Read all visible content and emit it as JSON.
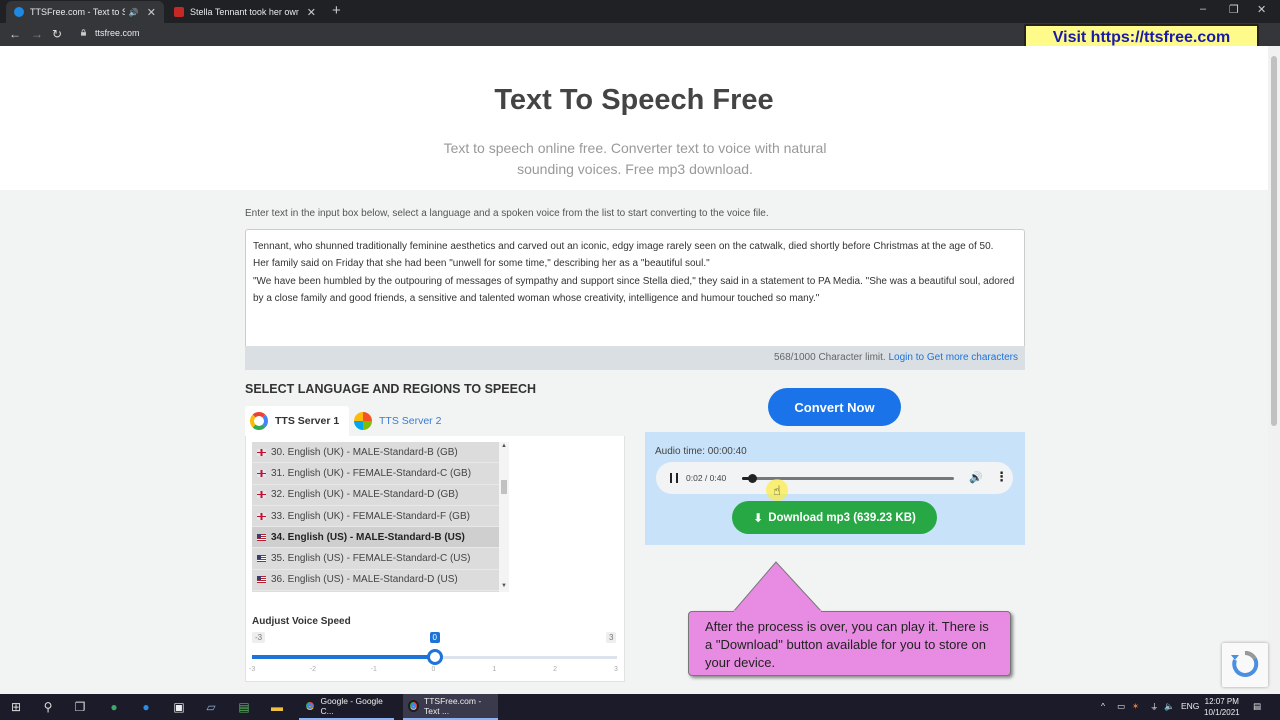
{
  "browser": {
    "tabs": [
      {
        "title": "TTSFree.com - Text to Speech",
        "icon": "ttsfree-favicon",
        "active": true
      },
      {
        "title": "Stella Tennant took her own life,",
        "icon": "news-favicon",
        "active": false
      }
    ],
    "url": "ttsfree.com",
    "window_controls": [
      "–",
      "❐",
      "✕"
    ]
  },
  "promo_banner": "Visit https://ttsfree.com",
  "hero": {
    "title": "Text To Speech Free",
    "subtitle": "Text to speech online free. Converter text to voice with natural sounding voices. Free mp3 download."
  },
  "instructions": "Enter text in the input box below, select a language and a spoken voice from the list to start converting to the voice file.",
  "input_text": [
    "Tennant, who shunned traditionally feminine aesthetics and carved out an iconic, edgy image rarely seen on the catwalk, died shortly before Christmas at the age of 50.",
    "Her family said on Friday that she had been \"unwell for some time,\" describing her as a \"beautiful soul.\"",
    "\"We have been humbled by the outpouring of messages of sympathy and support since Stella died,\" they said in a statement to PA Media. \"She was a beautiful soul, adored by a close family and good friends, a sensitive and talented woman whose creativity, intelligence and humour touched so many.\""
  ],
  "char_limit": {
    "count": "568/1000 Character limit.",
    "link": "Login to Get more characters"
  },
  "language_section_title": "SELECT LANGUAGE AND REGIONS TO SPEECH",
  "server_tabs": [
    {
      "label": "TTS Server 1",
      "icon": "google-icon",
      "active": true
    },
    {
      "label": "TTS Server 2",
      "icon": "microsoft-icon",
      "active": false
    }
  ],
  "voices": [
    {
      "label": "30. English (UK) - MALE-Standard-B (GB)",
      "flag": "uk",
      "selected": false
    },
    {
      "label": "31. English (UK) - FEMALE-Standard-C (GB)",
      "flag": "uk",
      "selected": false
    },
    {
      "label": "32. English (UK) - MALE-Standard-D (GB)",
      "flag": "uk",
      "selected": false
    },
    {
      "label": "33. English (UK) - FEMALE-Standard-F (GB)",
      "flag": "uk",
      "selected": false
    },
    {
      "label": "34. English (US) - MALE-Standard-B (US)",
      "flag": "us",
      "selected": true
    },
    {
      "label": "35. English (US) - FEMALE-Standard-C (US)",
      "flag": "us",
      "selected": false
    },
    {
      "label": "36. English (US) - MALE-Standard-D (US)",
      "flag": "us",
      "selected": false
    }
  ],
  "speed": {
    "label": "Audjust Voice Speed",
    "min": -3,
    "max": 3,
    "value": 0,
    "min_label": "-3",
    "max_label": "3",
    "value_label": "0",
    "ticks": [
      "-3",
      "-2",
      "-1",
      "0",
      "1",
      "2",
      "3"
    ]
  },
  "convert_button": "Convert Now",
  "player": {
    "audio_time": "Audio time: 00:00:40",
    "time_display": "0:02 / 0:40",
    "progress": 0.05
  },
  "download_button": "Download mp3 (639.23 KB)",
  "callout": "After the process is over, you can play it. There is a \"Download\" button available for you to store on your device.",
  "taskbar": {
    "apps": [
      {
        "label": "Google - Google C...",
        "current": false
      },
      {
        "label": "TTSFree.com - Text ...",
        "current": true
      }
    ],
    "lang": "ENG",
    "time": "12:07 PM",
    "date": "10/1/2021"
  },
  "colors": {
    "primary_blue": "#1a73e8",
    "download_green": "#28a745",
    "callout_pink": "#e88be3",
    "promo_yellow": "#fffb8a",
    "player_bg": "#c8e3f9"
  }
}
